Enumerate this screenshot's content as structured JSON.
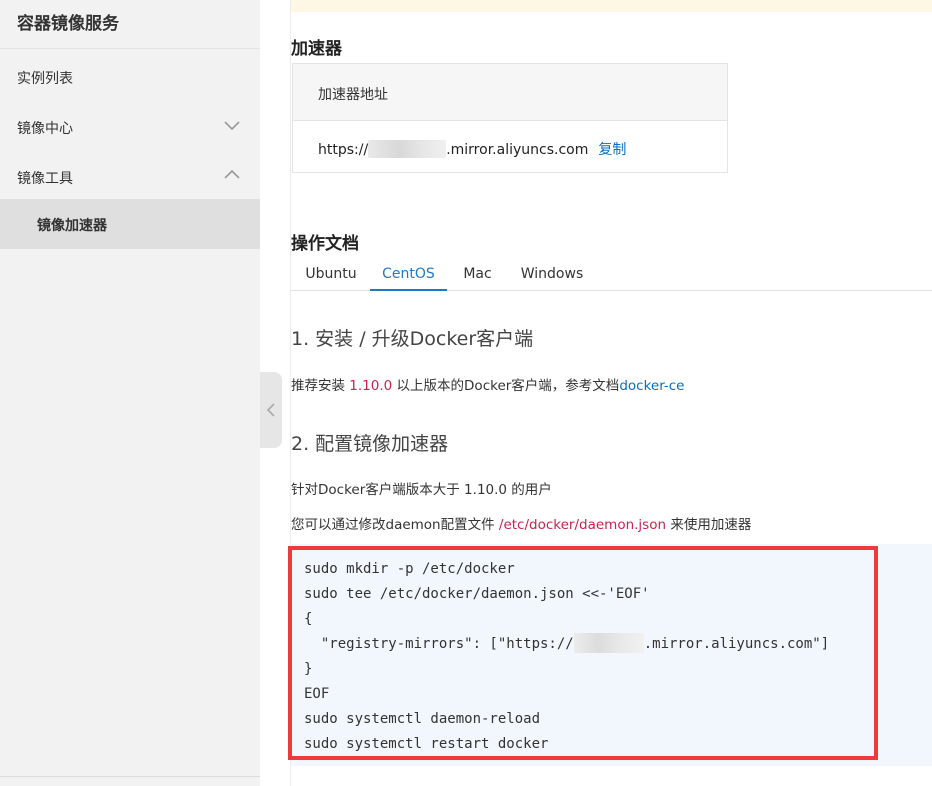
{
  "sidebar": {
    "title": "容器镜像服务",
    "items": [
      {
        "label": "实例列表"
      },
      {
        "label": "镜像中心",
        "chevron": "chevron-down-icon"
      },
      {
        "label": "镜像工具",
        "chevron": "chevron-up-icon"
      },
      {
        "label": "镜像加速器",
        "selected": true
      }
    ]
  },
  "accelerator": {
    "section_title": "加速器",
    "header": "加速器地址",
    "url_prefix": "https://",
    "url_suffix": ".mirror.aliyuncs.com",
    "copy_label": "复制"
  },
  "docs": {
    "section_title": "操作文档",
    "tabs": [
      {
        "label": "Ubuntu"
      },
      {
        "label": "CentOS",
        "active": true
      },
      {
        "label": "Mac"
      },
      {
        "label": "Windows"
      }
    ],
    "step1_title": "1. 安装 / 升级Docker客户端",
    "step1_pre": "推荐安装 ",
    "step1_version": "1.10.0",
    "step1_mid": " 以上版本的Docker客户端，参考文档",
    "step1_link": "docker-ce",
    "step2_title": "2. 配置镜像加速器",
    "step2_line1": "针对Docker客户端版本大于 1.10.0 的用户",
    "step2_line2_pre": "您可以通过修改daemon配置文件 ",
    "step2_path": "/etc/docker/daemon.json",
    "step2_line2_post": " 来使用加速器",
    "code": {
      "line1": "sudo mkdir -p /etc/docker",
      "line2": "sudo tee /etc/docker/daemon.json <<-'EOF'",
      "line3": "{",
      "line4_pre": "  \"registry-mirrors\": [\"https://",
      "line4_post": ".mirror.aliyuncs.com\"]",
      "line5": "}",
      "line6": "EOF",
      "line7": "sudo systemctl daemon-reload",
      "line8": "sudo systemctl restart docker"
    }
  },
  "colors": {
    "accent": "#1f78c1",
    "link": "#0a6fb7",
    "highlight_red": "#c7254e",
    "frame_red": "#ee3a3a",
    "sidebar_bg": "#f2f2f2",
    "selected_bg": "#dfdfdf"
  }
}
